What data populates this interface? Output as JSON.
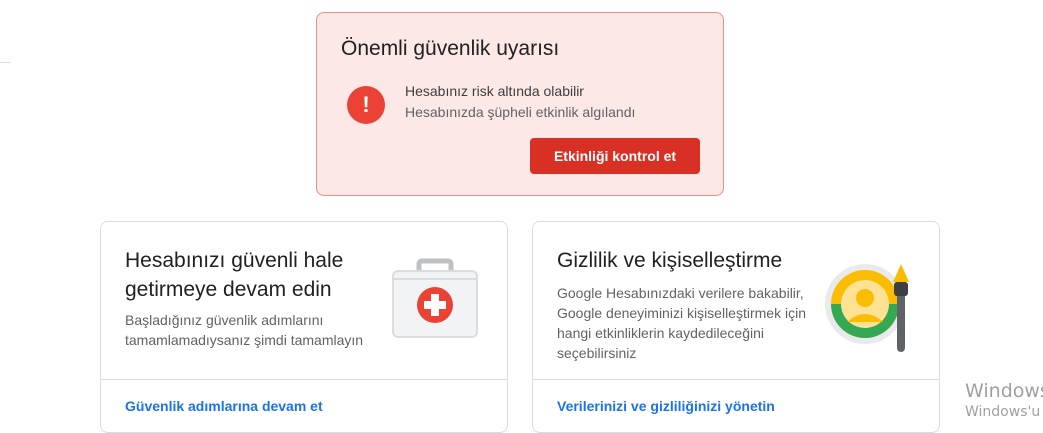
{
  "alert": {
    "title": "Önemli güvenlik uyarısı",
    "icon": "exclamation-icon",
    "line1": "Hesabınız risk altında olabilir",
    "line2": "Hesabınızda şüpheli etkinlik algılandı",
    "button_label": "Etkinliği kontrol et",
    "accent_color": "#d93025",
    "background_color": "#fce8e6"
  },
  "cards": [
    {
      "title": "Hesabınızı güvenli hale getirmeye devam edin",
      "description": "Başladığınız güvenlik adımlarını tamamlamadıysanız şimdi tamamlayın",
      "link_label": "Güvenlik adımlarına devam et",
      "illustration": "first-aid-kit-icon"
    },
    {
      "title": "Gizlilik ve kişiselleştirme",
      "description": "Google Hesabınızdaki verilere bakabilir, Google deneyiminizi kişiselleştirmek için hangi etkinliklerin kaydedileceğini seçebilirsiniz",
      "link_label": "Verilerinizi ve gizliliğinizi yönetin",
      "illustration": "privacy-person-brush-icon"
    }
  ],
  "watermark": {
    "line1": "Windows",
    "line2": "Windows'u e"
  },
  "colors": {
    "link": "#1a73e8",
    "danger": "#ea4335"
  }
}
